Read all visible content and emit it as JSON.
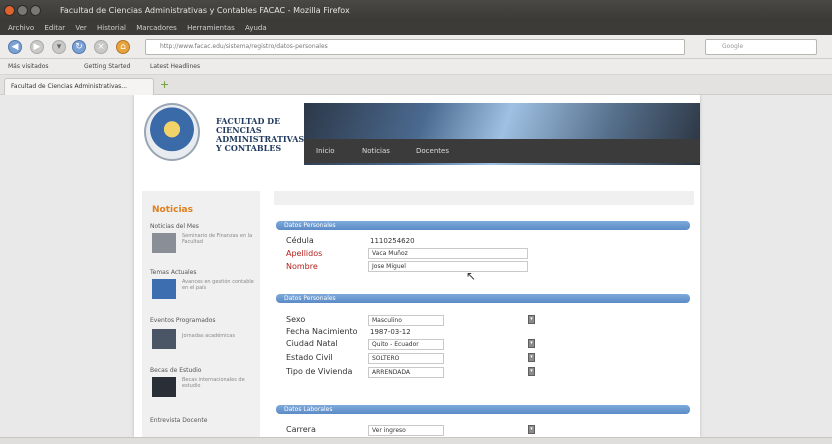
{
  "window": {
    "title": "Facultad de Ciencias Administrativas y Contables FACAC - Mozilla Firefox"
  },
  "menu": [
    "Archivo",
    "Editar",
    "Ver",
    "Historial",
    "Marcadores",
    "Herramientas",
    "Ayuda"
  ],
  "nav": {
    "url": "http://www.facac.edu/sistema/registro/datos-personales",
    "search_placeholder": "Google"
  },
  "bookmarks": [
    "Más visitados",
    "Getting Started",
    "Latest Headlines"
  ],
  "tab": {
    "title": "Facultad de Ciencias Administrativas..."
  },
  "site": {
    "faculty_name": "FACULTAD DE CIENCIAS ADMINISTRATIVAS Y CONTABLES",
    "menu": [
      "Inicio",
      "Noticias",
      "Docentes"
    ]
  },
  "sidebar": {
    "title": "Noticias",
    "items": [
      {
        "heading": "Noticias del Mes",
        "text": "Seminario de Finanzas en la Facultad"
      },
      {
        "heading": "Temas Actuales",
        "text": "Avances en gestión contable en el país"
      },
      {
        "heading": "Eventos Programados",
        "text": "Jornadas académicas"
      },
      {
        "heading": "Becas de Estudio",
        "text": "Becas internacionales de estudio"
      },
      {
        "heading": "Entrevista Docente",
        "text": ""
      }
    ]
  },
  "form": {
    "section1": {
      "title": "Datos Personales",
      "cedula_label": "Cédula",
      "cedula_value": "1110254620",
      "apellidos_label": "Apellidos",
      "apellidos_value": "Vaca Muñoz",
      "nombre_label": "Nombre",
      "nombre_value": "Jose Miguel"
    },
    "section2": {
      "title": "Datos Personales",
      "sexo_label": "Sexo",
      "sexo_value": "Masculino",
      "fecha_label": "Fecha Nacimiento",
      "fecha_value": "1987-03-12",
      "ciudad_label": "Ciudad Natal",
      "ciudad_value": "Quito - Ecuador",
      "estado_label": "Estado Civil",
      "estado_value": "SOLTERO",
      "vivienda_label": "Tipo de Vivienda",
      "vivienda_value": "ARRENDADA"
    },
    "section3": {
      "title": "Datos Laborales",
      "carrera_label": "Carrera",
      "carrera_value": "Ver ingreso"
    }
  },
  "icons": {
    "close": "close-icon",
    "back": "back-arrow-icon",
    "forward": "forward-arrow-icon",
    "reload": "reload-icon",
    "home": "home-icon",
    "stop": "stop-icon",
    "select": "dropdown-icon"
  }
}
